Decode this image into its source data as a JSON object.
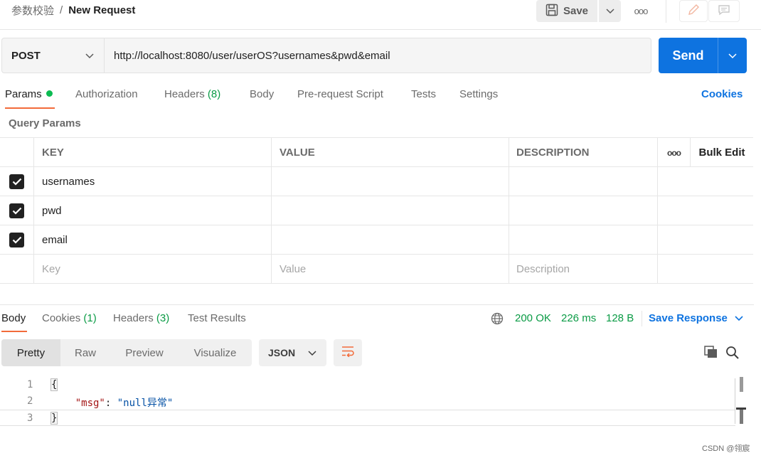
{
  "breadcrumb": {
    "parent": "参数校验",
    "separator": "/",
    "current": "New Request"
  },
  "toolbar": {
    "save_label": "Save",
    "more_label": "ooo"
  },
  "request": {
    "method": "POST",
    "url": "http://localhost:8080/user/userOS?usernames&pwd&email",
    "send_label": "Send"
  },
  "request_tabs": {
    "params": "Params",
    "authorization": "Authorization",
    "headers": "Headers",
    "headers_count": "(8)",
    "body": "Body",
    "pre_request": "Pre-request Script",
    "tests": "Tests",
    "settings": "Settings",
    "cookies": "Cookies"
  },
  "query_params": {
    "title": "Query Params",
    "headers": {
      "key": "KEY",
      "value": "VALUE",
      "description": "DESCRIPTION",
      "more": "ooo",
      "bulk_edit": "Bulk Edit"
    },
    "rows": [
      {
        "key": "usernames",
        "value": "",
        "description": "",
        "checked": true
      },
      {
        "key": "pwd",
        "value": "",
        "description": "",
        "checked": true
      },
      {
        "key": "email",
        "value": "",
        "description": "",
        "checked": true
      }
    ],
    "placeholders": {
      "key": "Key",
      "value": "Value",
      "description": "Description"
    }
  },
  "response_tabs": {
    "body": "Body",
    "cookies": "Cookies",
    "cookies_count": "(1)",
    "headers": "Headers",
    "headers_count": "(3)",
    "test_results": "Test Results"
  },
  "response_status": {
    "status": "200 OK",
    "time": "226 ms",
    "size": "128 B",
    "save_response": "Save Response"
  },
  "format_options": {
    "pretty": "Pretty",
    "raw": "Raw",
    "preview": "Preview",
    "visualize": "Visualize",
    "language": "JSON"
  },
  "code": {
    "line_numbers": [
      "1",
      "2",
      "3"
    ],
    "open_brace": "{",
    "indent": "    ",
    "key": "\"msg\"",
    "colon": ": ",
    "value": "\"null异常\"",
    "close_brace": "}"
  },
  "watermark": "CSDN @翎宸",
  "colors": {
    "accent": "#0e73e0",
    "tab_underline": "#f26b3a",
    "success": "#0a9b45",
    "status_dot": "#0cbb52"
  }
}
